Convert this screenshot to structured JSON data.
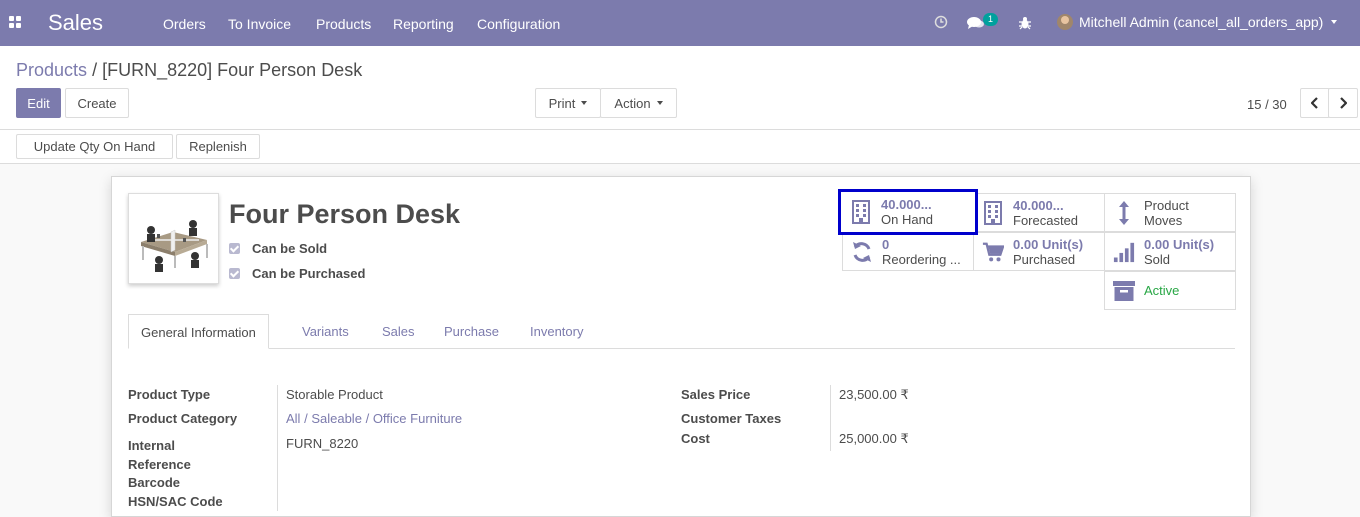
{
  "navbar": {
    "brand": "Sales",
    "menu": [
      "Orders",
      "To Invoice",
      "Products",
      "Reporting",
      "Configuration"
    ],
    "messages_badge": "1",
    "user": "Mitchell Admin (cancel_all_orders_app)"
  },
  "breadcrumb": {
    "parent": "Products",
    "separator": "/",
    "current": "[FURN_8220] Four Person Desk"
  },
  "buttons": {
    "edit": "Edit",
    "create": "Create",
    "print": "Print",
    "action": "Action",
    "update_qty": "Update Qty On Hand",
    "replenish": "Replenish"
  },
  "pager": {
    "value": "15 / 30"
  },
  "product": {
    "name": "Four Person Desk",
    "can_be_sold": "Can be Sold",
    "can_be_purchased": "Can be Purchased"
  },
  "smart_buttons": {
    "on_hand": {
      "value": "40.000...",
      "label": "On Hand"
    },
    "forecasted": {
      "value": "40.000...",
      "label": "Forecasted"
    },
    "moves": {
      "line1": "Product",
      "line2": "Moves"
    },
    "reordering": {
      "value": "0",
      "label": "Reordering ..."
    },
    "purchased": {
      "value": "0.00",
      "unit": "Unit(s)",
      "label": "Purchased"
    },
    "sold": {
      "value": "0.00",
      "unit": "Unit(s)",
      "label": "Sold"
    },
    "active": {
      "label": "Active"
    }
  },
  "tabs": [
    "General Information",
    "Variants",
    "Sales",
    "Purchase",
    "Inventory"
  ],
  "fields": {
    "product_type": {
      "label": "Product Type",
      "value": "Storable Product"
    },
    "product_category": {
      "label": "Product Category",
      "all": "All",
      "sep1": "/",
      "mid": "Saleable",
      "sep2": "/",
      "last": "Office Furniture"
    },
    "internal_reference": {
      "label1": "Internal",
      "label2": "Reference",
      "value": "FURN_8220"
    },
    "barcode": {
      "label": "Barcode"
    },
    "hsn": {
      "label": "HSN/SAC Code"
    },
    "sales_price": {
      "label": "Sales Price",
      "value": "23,500.00 ₹"
    },
    "customer_taxes": {
      "label": "Customer Taxes"
    },
    "cost": {
      "label": "Cost",
      "value": "25,000.00 ₹"
    }
  },
  "colors": {
    "brand": "#7c7bad",
    "active": "#28a745",
    "highlight": "#0000cc"
  }
}
